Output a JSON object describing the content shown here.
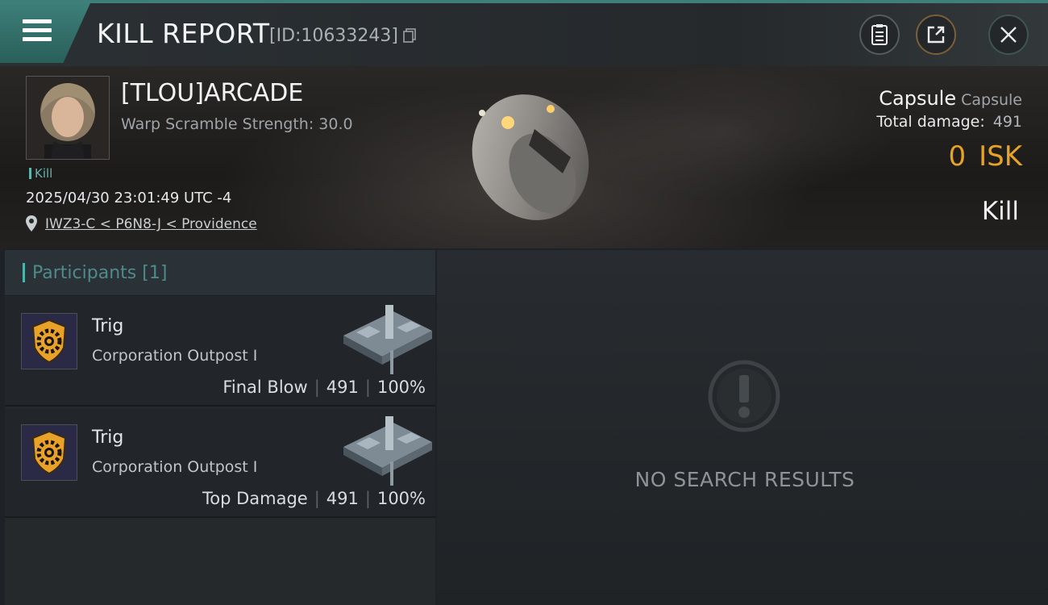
{
  "header": {
    "title": "KILL REPORT",
    "report_id": "[ID:10633243]"
  },
  "victim": {
    "name": "[TLOU]ARCADE",
    "warp_scramble": "Warp Scramble Strength: 30.0",
    "tag": "Kill",
    "datetime": "2025/04/30 23:01:49 UTC -4",
    "location": "IWZ3-C < P6N8-J < Providence"
  },
  "ship": {
    "name": "Capsule",
    "class": "Capsule",
    "damage_label": "Total damage:",
    "damage_value": "491",
    "isk_value": "0",
    "isk_unit": "ISK",
    "result": "Kill"
  },
  "participants": {
    "label": "Participants",
    "count": "[1]",
    "rows": [
      {
        "name": "Trig",
        "corp": "Corporation Outpost I",
        "role": "Final Blow",
        "damage": "491",
        "percent": "100%"
      },
      {
        "name": "Trig",
        "corp": "Corporation Outpost I",
        "role": "Top Damage",
        "damage": "491",
        "percent": "100%"
      }
    ]
  },
  "results": {
    "empty_text": "NO SEARCH RESULTS"
  },
  "colors": {
    "accent_teal": "#3f7f79",
    "isk_gold": "#e6a325"
  }
}
